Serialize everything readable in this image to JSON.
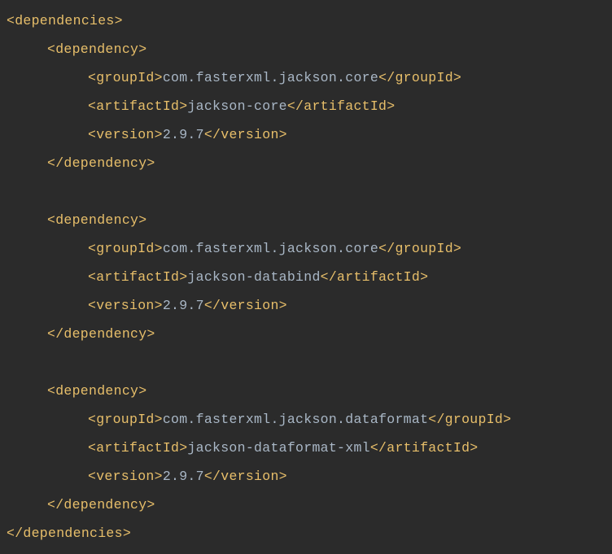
{
  "root": {
    "open": "<dependencies>",
    "close": "</dependencies>"
  },
  "dep": {
    "open": "<dependency>",
    "close": "</dependency>"
  },
  "tags": {
    "groupId_open": "<groupId>",
    "groupId_close": "</groupId>",
    "artifactId_open": "<artifactId>",
    "artifactId_close": "</artifactId>",
    "version_open": "<version>",
    "version_close": "</version>"
  },
  "dependencies": [
    {
      "groupId": "com.fasterxml.jackson.core",
      "artifactId": "jackson-core",
      "version": "2.9.7"
    },
    {
      "groupId": "com.fasterxml.jackson.core",
      "artifactId": "jackson-databind",
      "version": "2.9.7"
    },
    {
      "groupId": "com.fasterxml.jackson.dataformat",
      "artifactId": "jackson-dataformat-xml",
      "version": "2.9.7"
    }
  ]
}
